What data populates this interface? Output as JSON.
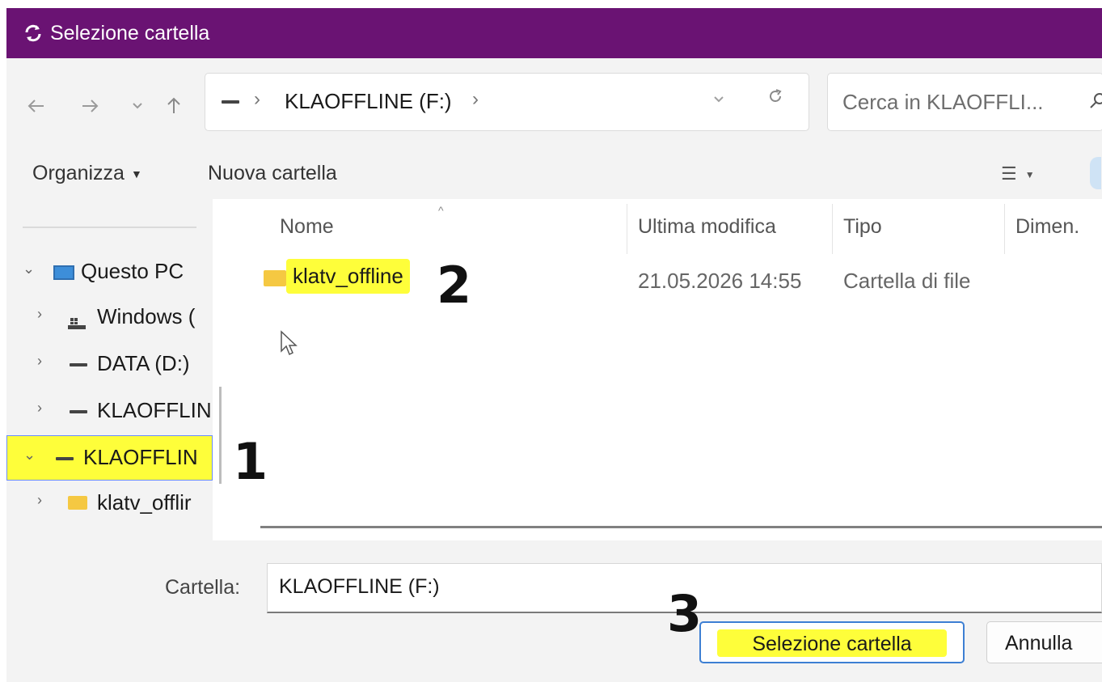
{
  "window": {
    "title": "Selezione cartella",
    "icon": "refresh-icon",
    "accent": "#6a1373"
  },
  "nav": {
    "back_icon": "arrow-left-icon",
    "forward_icon": "arrow-right-icon",
    "recent_icon": "chevron-down-icon",
    "up_icon": "arrow-up-icon",
    "address_segment": "KLAOFFLINE (F:)",
    "search_placeholder": "Cerca in KLAOFFLI..."
  },
  "toolbar": {
    "organize_label": "Organizza",
    "new_folder_label": "Nuova cartella"
  },
  "sidebar": {
    "items": [
      {
        "label": "Questo PC",
        "icon": "computer-icon",
        "expanded": true
      },
      {
        "label": "Windows (",
        "icon": "windows-drive-icon",
        "expanded": false
      },
      {
        "label": "DATA (D:)",
        "icon": "drive-icon",
        "expanded": false
      },
      {
        "label": "KLAOFFLIN",
        "icon": "drive-icon",
        "expanded": false
      },
      {
        "label": "KLAOFFLIN",
        "icon": "drive-icon",
        "expanded": true,
        "selected": true
      },
      {
        "label": "klatv_offlir",
        "icon": "folder-icon",
        "expanded": false
      }
    ]
  },
  "columns": {
    "name": "Nome",
    "modified": "Ultima modifica",
    "type": "Tipo",
    "size": "Dimen."
  },
  "files": [
    {
      "name": "klatv_offline",
      "modified": "21.05.2026 14:55",
      "type": "Cartella di file"
    }
  ],
  "footer": {
    "folder_label": "Cartella:",
    "folder_value": "KLAOFFLINE (F:)",
    "select_label": "Selezione cartella",
    "cancel_label": "Annulla"
  },
  "annotations": {
    "step1": "1",
    "step2": "2",
    "step3": "3"
  },
  "colors": {
    "highlight": "#fefe3a",
    "title_bar": "#6a1373",
    "selection_border": "#3d7fd3"
  }
}
